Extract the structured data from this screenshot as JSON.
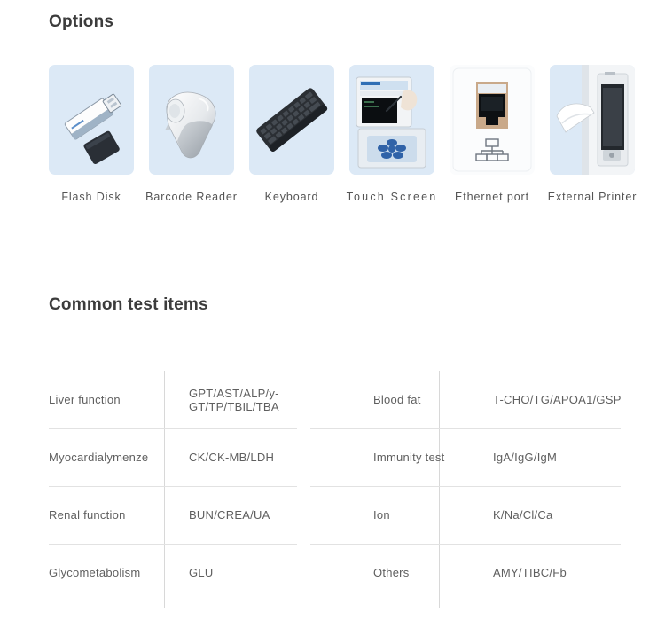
{
  "sections": {
    "options_heading": "Options",
    "tests_heading": "Common test items"
  },
  "options": {
    "items": [
      {
        "label": "Flash Disk",
        "icon": "usb-flash-drive-icon",
        "tile": "blue",
        "tracking": "normal"
      },
      {
        "label": "Barcode Reader",
        "icon": "barcode-scanner-icon",
        "tile": "blue",
        "tracking": "normal"
      },
      {
        "label": "Keyboard",
        "icon": "keyboard-icon",
        "tile": "blue",
        "tracking": "normal"
      },
      {
        "label": "Touch Screen",
        "icon": "touch-screen-icon",
        "tile": "blue",
        "tracking": "wide"
      },
      {
        "label": "Ethernet port",
        "icon": "ethernet-port-icon",
        "tile": "white",
        "tracking": "normal"
      },
      {
        "label": "External Printer",
        "icon": "printer-icon",
        "tile": "blue",
        "tracking": "normal"
      }
    ]
  },
  "tests": {
    "rows": [
      {
        "left_label": "Liver function",
        "left_value": "GPT/AST/ALP/y-GT/TP/TBIL/TBA",
        "right_label": "Blood fat",
        "right_value": "T-CHO/TG/APOA1/GSP"
      },
      {
        "left_label": "Myocardialymenze",
        "left_value": "CK/CK-MB/LDH",
        "right_label": "Immunity test",
        "right_value": "IgA/IgG/IgM"
      },
      {
        "left_label": "Renal function",
        "left_value": "BUN/CREA/UA",
        "right_label": "Ion",
        "right_value": "K/Na/Cl/Ca"
      },
      {
        "left_label": "Glycometabolism",
        "left_value": "GLU",
        "right_label": "Others",
        "right_value": "AMY/TIBC/Fb"
      }
    ]
  },
  "colors": {
    "label_blue": "#2b5fc4",
    "value_grey": "#5f5f5f",
    "heading_dark": "#3c3c3c",
    "tile_blue": "#dce9f6",
    "rule_grey": "#d8d8d8"
  }
}
